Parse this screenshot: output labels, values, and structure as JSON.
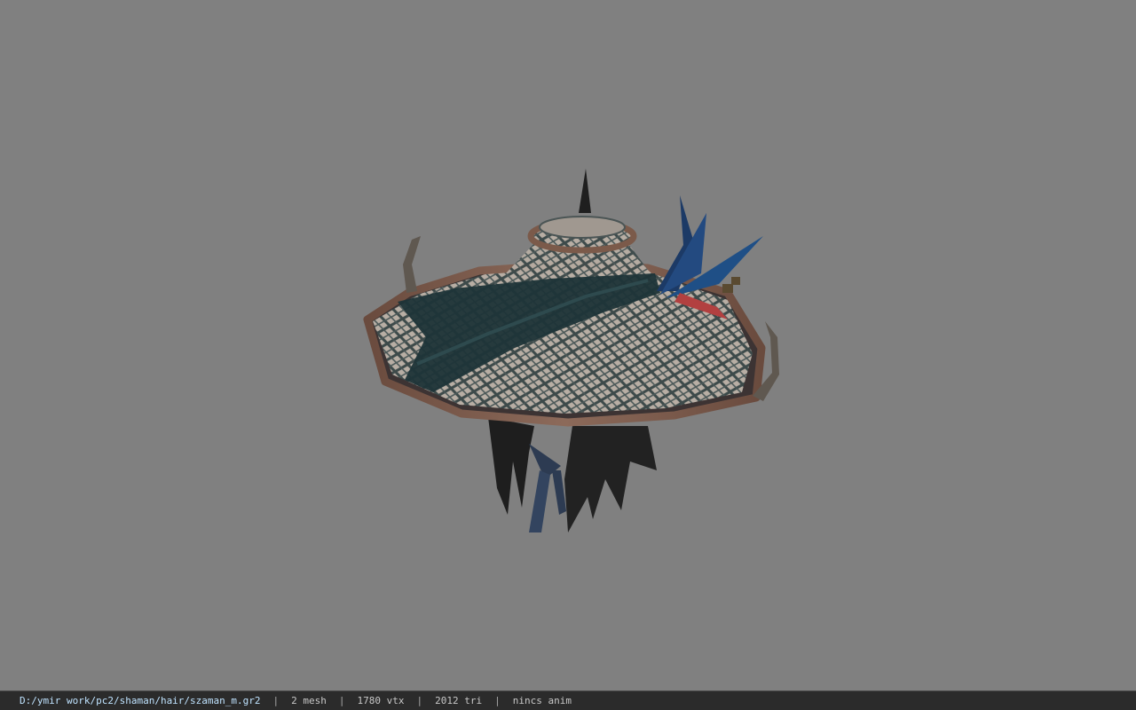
{
  "viewport": {
    "background_color": "#808080",
    "model": {
      "icon": "conical-hat-3d-model"
    }
  },
  "status_bar": {
    "file_path": "D:/ymir work/pc2/shaman/hair/szaman_m.gr2",
    "separator": "|",
    "mesh_count": "2 mesh",
    "vertex_count": "1780 vtx",
    "triangle_count": "2012 tri",
    "anim_status": "nincs anim"
  }
}
